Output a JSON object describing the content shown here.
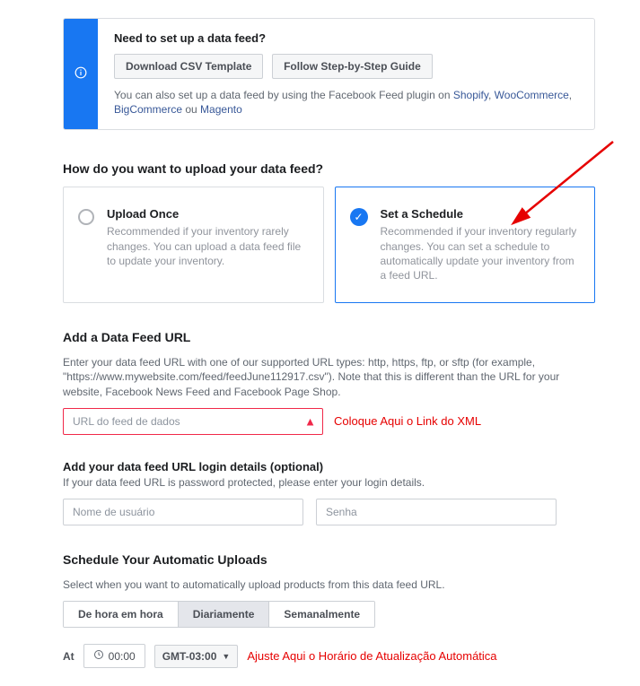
{
  "info": {
    "title": "Need to set up a data feed?",
    "btn_csv": "Download CSV Template",
    "btn_guide": "Follow Step-by-Step Guide",
    "text_prefix": "You can also set up a data feed by using the Facebook Feed plugin on ",
    "link_shopify": "Shopify",
    "link_woo": "WooCommerce",
    "link_big": "BigCommerce",
    "sep1": ", ",
    "sep2": ", ",
    "sep3": " ou ",
    "link_magento": "Magento"
  },
  "upload": {
    "heading": "How do you want to upload your data feed?",
    "opt1": {
      "title": "Upload Once",
      "desc": "Recommended if your inventory rarely changes. You can upload a data feed file to update your inventory."
    },
    "opt2": {
      "title": "Set a Schedule",
      "desc": "Recommended if your inventory regularly changes. You can set a schedule to automatically update your inventory from a feed URL."
    }
  },
  "feedurl": {
    "title": "Add a Data Feed URL",
    "desc": "Enter your data feed URL with one of our supported URL types: http, https, ftp, or sftp (for example, \"https://www.mywebsite.com/feed/feedJune112917.csv\"). Note that this is different than the URL for your website, Facebook News Feed and Facebook Page Shop.",
    "placeholder": "URL do feed de dados",
    "annot": "Coloque Aqui o Link do XML"
  },
  "login": {
    "title": "Add your data feed URL login details (optional)",
    "desc": "If your data feed URL is password protected, please enter your login details.",
    "user_placeholder": "Nome de usuário",
    "pass_placeholder": "Senha"
  },
  "schedule": {
    "title": "Schedule Your Automatic Uploads",
    "desc": "Select when you want to automatically upload products from this data feed URL.",
    "seg_hourly": "De hora em hora",
    "seg_daily": "Diariamente",
    "seg_weekly": "Semanalmente",
    "at_label": "At",
    "time": "00:00",
    "tz": "GMT-03:00",
    "annot": "Ajuste Aqui o Horário de Atualização Automática"
  }
}
